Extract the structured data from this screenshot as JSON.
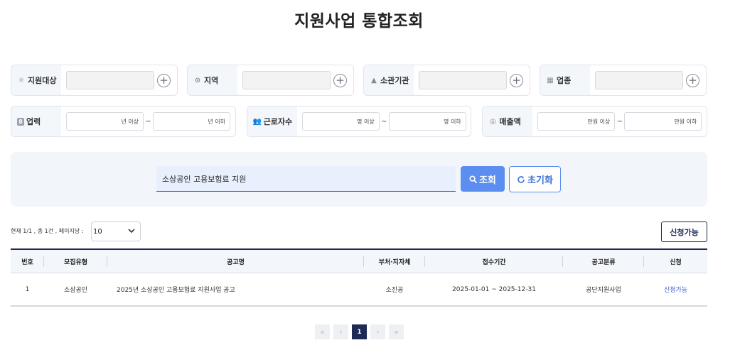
{
  "page": {
    "title": "지원사업 통합조회"
  },
  "filters_row1": [
    {
      "label": "지원대상",
      "icon": "lightbulb-icon",
      "icon_glyph": "☼"
    },
    {
      "label": "지역",
      "icon": "location-pin-icon",
      "icon_glyph": "⊙"
    },
    {
      "label": "소관기관",
      "icon": "institution-icon",
      "icon_glyph": "▲"
    },
    {
      "label": "업종",
      "icon": "industry-icon",
      "icon_glyph": "▦"
    }
  ],
  "filters_row2": [
    {
      "label": "업력",
      "icon": "years-badge-icon",
      "icon_glyph": "8",
      "min_unit": "년 이상",
      "max_unit": "년 이하"
    },
    {
      "label": "근로자수",
      "icon": "workers-icon",
      "icon_glyph": "👥",
      "min_unit": "명 이상",
      "max_unit": "명 이하"
    },
    {
      "label": "매출액",
      "icon": "coins-icon",
      "icon_glyph": "◎",
      "min_unit": "만원 이상",
      "max_unit": "만원 이하"
    }
  ],
  "range_separator": "~",
  "plus_glyph": "+",
  "search": {
    "value": "소상공인 고용보험료 지원",
    "button_label": "조회",
    "reset_label": "초기화"
  },
  "results": {
    "info": "현재 1/1 , 총 1건 , 페이지당 :",
    "page_size": "10",
    "apply_filter_label": "신청가능"
  },
  "table": {
    "headers": [
      "번호",
      "모집유형",
      "공고명",
      "부처·지자체",
      "접수기간",
      "공고분류",
      "신청"
    ],
    "rows": [
      [
        "1",
        "소상공인",
        "2025년 소상공인 고용보험료 지원사업 공고",
        "소진공",
        "2025-01-01 ~ 2025-12-31",
        "공단지원사업",
        "신청가능"
      ]
    ]
  },
  "pagination": {
    "first": "«",
    "prev": "‹",
    "current": "1",
    "next": "›",
    "last": "»"
  },
  "colors": {
    "accent": "#5b8ef0",
    "navy": "#1c2a55",
    "link": "#3d55c8",
    "panel": "#f2f5fa"
  }
}
